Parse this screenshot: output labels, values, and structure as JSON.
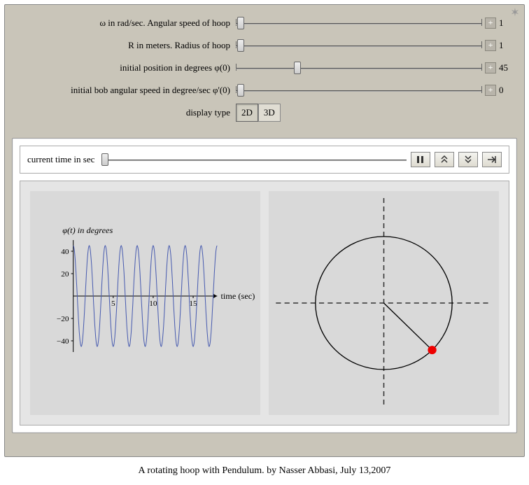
{
  "controls": {
    "omega": {
      "label": "ω in rad/sec. Angular speed of hoop",
      "value": "1",
      "thumb_pct": 2
    },
    "radius": {
      "label": "R in meters. Radius of hoop",
      "value": "1",
      "thumb_pct": 2
    },
    "initpos": {
      "label": "initial position in degrees φ(0)",
      "value": "45",
      "thumb_pct": 25
    },
    "initspeed": {
      "label": "initial bob angular speed in degree/sec φ'(0)",
      "value": "0",
      "thumb_pct": 2
    },
    "display": {
      "label": "display type",
      "option_a": "2D",
      "option_b": "3D"
    }
  },
  "time": {
    "label": "current time in sec",
    "thumb_pct": 1
  },
  "left_plot": {
    "ylabel": "φ(t) in degrees",
    "xlabel": "time (sec)",
    "yticks": [
      "40",
      "20",
      "-20",
      "-40"
    ],
    "xticks": [
      "5",
      "10",
      "15"
    ]
  },
  "caption": "A rotating hoop with Pendulum. by Nasser Abbasi, July 13,2007",
  "chart_data": {
    "type": "line",
    "title": "φ(t) in degrees",
    "xlabel": "time (sec)",
    "ylabel": "φ(t) in degrees",
    "xlim": [
      0,
      18
    ],
    "ylim": [
      -50,
      50
    ],
    "xticks": [
      5,
      10,
      15
    ],
    "yticks": [
      -40,
      -20,
      20,
      40
    ],
    "series": [
      {
        "name": "phi",
        "amplitude_deg": 45,
        "period_sec": 2,
        "x_sampled": [
          0,
          0.5,
          1.0,
          1.5,
          2.0,
          2.5,
          3.0,
          3.5,
          4.0,
          4.5,
          5.0,
          5.5,
          6.0,
          6.5,
          7.0,
          7.5,
          8.0,
          8.5,
          9.0,
          9.5,
          10.0,
          10.5,
          11.0,
          11.5,
          12.0,
          12.5,
          13.0,
          13.5,
          14.0,
          14.5,
          15.0,
          15.5,
          16.0,
          16.5,
          17.0,
          17.5,
          18.0
        ],
        "y_sampled": [
          45,
          0,
          -45,
          0,
          45,
          0,
          -45,
          0,
          45,
          0,
          -45,
          0,
          45,
          0,
          -45,
          0,
          45,
          0,
          -45,
          0,
          45,
          0,
          -45,
          0,
          45,
          0,
          -45,
          0,
          45,
          0,
          -45,
          0,
          45,
          0,
          -45,
          0,
          45
        ]
      }
    ]
  },
  "hoop": {
    "phi_deg": -45,
    "radius": 1
  }
}
